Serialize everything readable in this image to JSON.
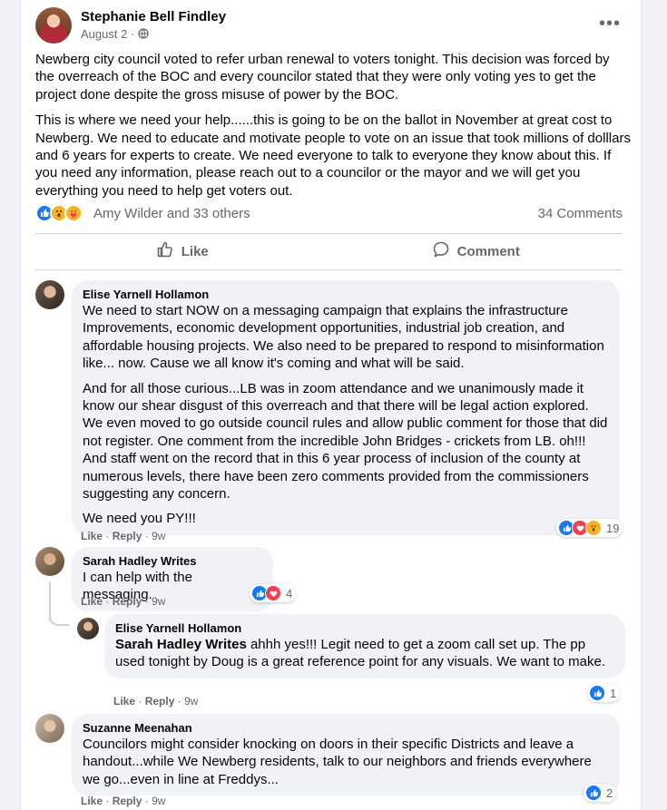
{
  "post": {
    "author": "Stephanie Bell Findley",
    "date": "August 2",
    "audience_icon": "globe-icon",
    "paragraphs": [
      "Newberg city council voted to refer urban renewal to voters tonight. This decision was forced by the overreach of the BOC and every councilor stated that they were only voting yes to get the project done despite the gross misuse of power by the BOC.",
      "This is where we need your help......this is going to be on the ballot in November at great cost to Newberg. We need to educate and motivate people to vote on an issue that took millions of dolllars and 6 years for experts to create. We need everyone to talk to everyone they know about this. If you need any information, please reach out to a councilor or the mayor and we will get you everything you need to help get voters out."
    ],
    "reactors_text": "Amy Wilder and 33 others",
    "comments_count": "34 Comments",
    "like_label": "Like",
    "comment_label": "Comment",
    "reaction_icons": [
      "like-icon",
      "wow-icon",
      "care-icon"
    ]
  },
  "comments": [
    {
      "author": "Elise Yarnell Hollamon",
      "paragraphs": [
        "We need to start NOW on a messaging campaign that explains the infrastructure Improvements, economic development opportunities, industrial job creation, and affordable housing projects. We also need to be prepared to respond to misinformation like... now. Cause we all know it's coming and what will be said.",
        "And for all those curious...LB was in zoom attendance and we unanimously made it know our shear disgust of this overreach and that there will be legal action explored. We even moved to go outside council rules and allow public comment for those that did not register. One comment from the incredible John Bridges - crickets from LB. oh!!! And staff went on the record that in this 6 year process of inclusion of the county at numerous levels, there have been zero comments provided from the commissioners suggesting any concern.",
        "We need you PY!!!"
      ],
      "like": "Like",
      "reply": "Reply",
      "time": "9w",
      "reaction_count": "19"
    },
    {
      "author": "Sarah Hadley Writes",
      "text": "I can help with the messaging.",
      "like": "Like",
      "reply": "Reply",
      "time": "9w",
      "reaction_count": "4"
    },
    {
      "author": "Elise Yarnell Hollamon",
      "mention": "Sarah Hadley Writes",
      "text": " ahhh yes!!! Legit need to get a zoom call set up. The pp used tonight by Doug is a great reference point for any visuals. We want to make.",
      "like": "Like",
      "reply": "Reply",
      "time": "9w",
      "reaction_count": "1"
    },
    {
      "author": "Suzanne Meenahan",
      "text": "Councilors might consider knocking on doors in their specific Districts and leave a handout...while We Newberg residents, talk to our neighbors and friends everywhere we go...even in line at Freddys...",
      "like": "Like",
      "reply": "Reply",
      "time": "9w",
      "reaction_count": "2"
    }
  ],
  "separator": "·",
  "colors": {
    "like_blue": "#1877f2",
    "love_red": "#f33e58",
    "wow_yellow": "#f7b125",
    "secondary_text": "#65676b",
    "bubble_bg": "#f0f2f5"
  }
}
